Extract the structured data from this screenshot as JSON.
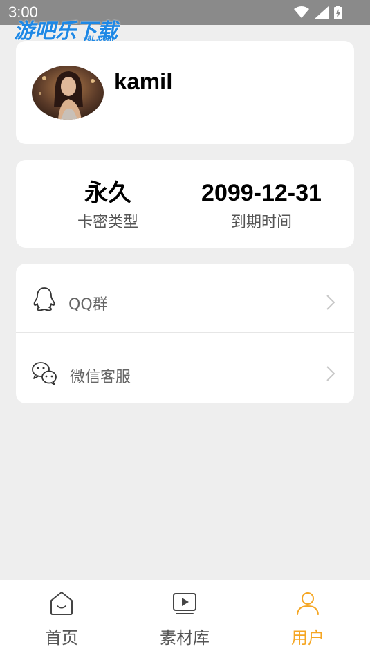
{
  "status_bar": {
    "time": "3:00",
    "icons": [
      "wifi-icon",
      "signal-icon",
      "battery-charging-icon"
    ]
  },
  "watermark": {
    "text": "游吧乐下载",
    "sub": "y8L.com"
  },
  "profile": {
    "username": "kamil"
  },
  "membership": {
    "card_type_value": "永久",
    "card_type_label": "卡密类型",
    "expiry_value": "2099-12-31",
    "expiry_label": "到期时间"
  },
  "menu": {
    "items": [
      {
        "label": "QQ群",
        "icon": "qq-icon"
      },
      {
        "label": "微信客服",
        "icon": "wechat-icon"
      }
    ]
  },
  "tabbar": {
    "items": [
      {
        "label": "首页",
        "icon": "home-icon"
      },
      {
        "label": "素材库",
        "icon": "video-library-icon"
      },
      {
        "label": "用户",
        "icon": "user-icon",
        "active": true
      }
    ],
    "active_color": "#f5a623"
  }
}
